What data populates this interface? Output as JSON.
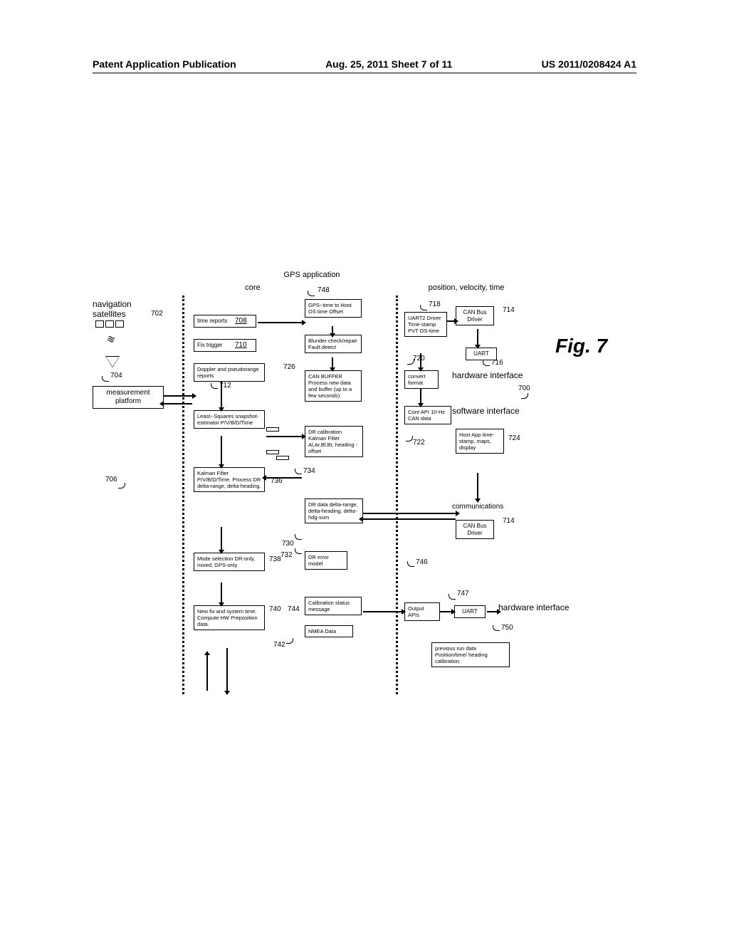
{
  "header": {
    "left": "Patent Application Publication",
    "center": "Aug. 25, 2011  Sheet 7 of 11",
    "right": "US 2011/0208424 A1"
  },
  "fig_label": "Fig. 7",
  "titles": {
    "gps_app": "GPS application",
    "core": "core",
    "pvt": "position, velocity, time",
    "nav_sat_1": "navigation",
    "nav_sat_2": "satellites",
    "meas_platform_1": "measurement",
    "meas_platform_2": "platform",
    "hw_if": "hardware interface",
    "sw_if": "software interface",
    "comms": "communications",
    "hw_if2": "hardware interface"
  },
  "refs": {
    "r700": "700",
    "r702": "702",
    "r704": "704",
    "r706": "706",
    "r708": "708",
    "r710": "710",
    "r712": "712",
    "r714": "714",
    "r714b": "714",
    "r716": "716",
    "r718": "718",
    "r720": "720",
    "r722": "722",
    "r724": "724",
    "r726": "726",
    "r730": "730",
    "r732": "732",
    "r734": "734",
    "r736": "736",
    "r738": "738",
    "r740": "740",
    "r742": "742",
    "r744": "744",
    "r746": "746",
    "r747": "747",
    "r748": "748",
    "r750": "750"
  },
  "boxes": {
    "time_reports": "time reports",
    "fix_trigger": "Fix trigger",
    "doppler": "Doppler and pseudorange reports",
    "lsq": "Least--Squares snapshot-estimator P/V/B/D/Time",
    "kf": "Kalman Filter P/V/B/D/Time. Process DR delta-range, delta-heading.",
    "mode": "Mode selection DR-only, mixed, GPS-only",
    "newfix": "New fix and system time. Compute HW Preposition data.",
    "gps_offset": "GPS--time to Host OS time Offset",
    "blunder": "Blunder check/repair Fault detect",
    "canbuf": "CAN BUFFER Process new data and buffer (up to a few seconds)",
    "drcal": "DR calibration Kalman Filter Al,Ar,Bl,Br, heading - offset",
    "drdata": "DR data delta-range, delta-heading, delta-hdg-sum",
    "drerr": "DR error model",
    "calstatus": "Calibration status message",
    "nmea": "NMEA Data",
    "uart2": "UART2 Driver Time-stamp PVT OS-time",
    "convfmt": "convert format",
    "coreapi": "Core API 10-Hz CAN data",
    "output_api": "Output APIs",
    "canbus": "CAN Bus Driver",
    "canbus2": "CAN Bus Driver",
    "uart": "UART",
    "uart_b": "UART",
    "hostapp": "Host App time-stamp, maps, display",
    "prevrun": "previous run data Position/time/ heading calibration"
  }
}
